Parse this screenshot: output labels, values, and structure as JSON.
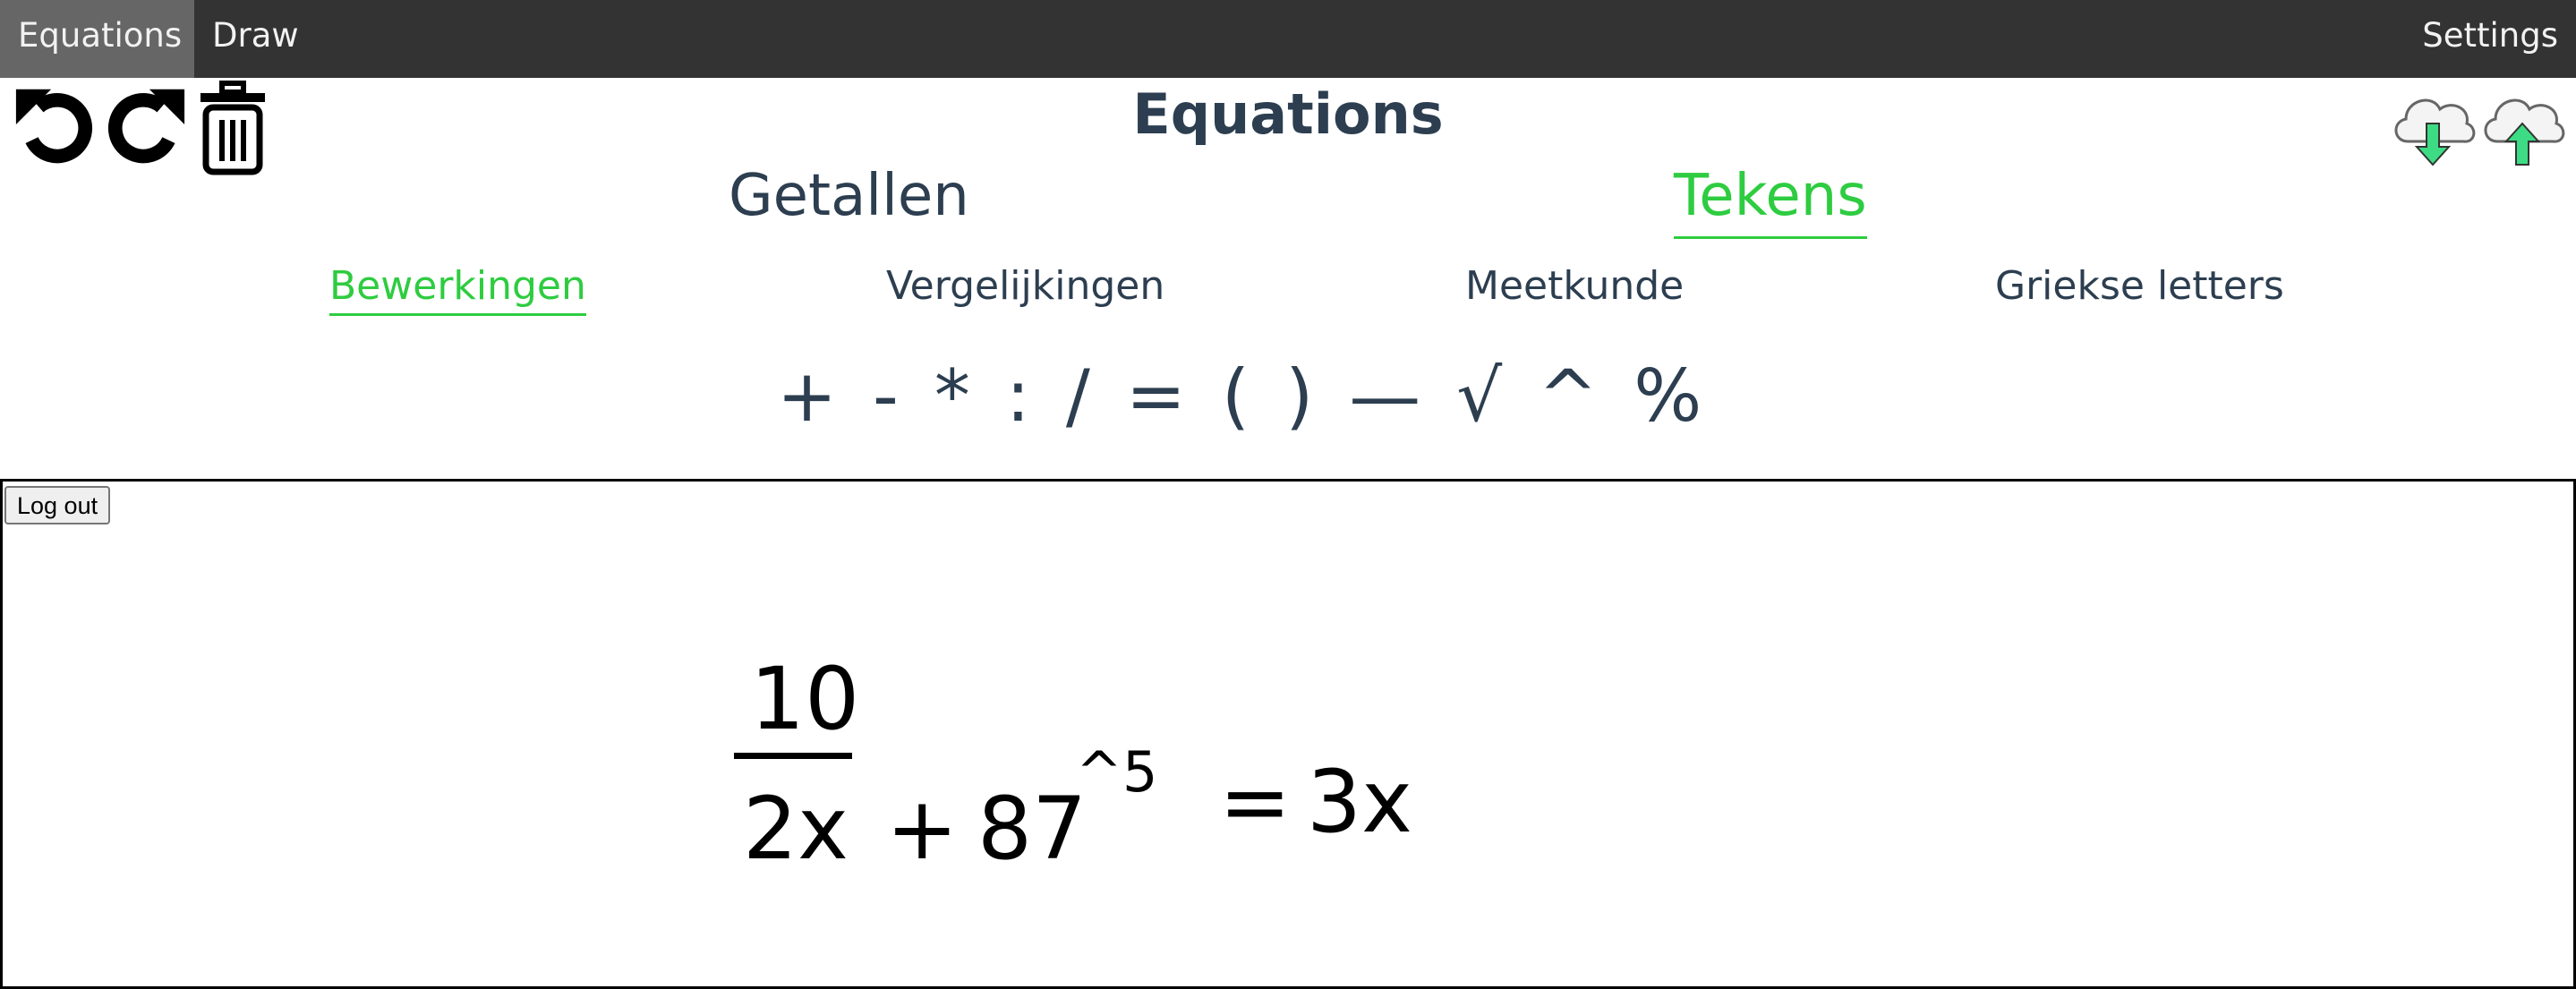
{
  "nav": {
    "equations": "Equations",
    "draw": "Draw",
    "settings": "Settings"
  },
  "toolbar": {
    "icons": [
      "undo-icon",
      "redo-icon",
      "trash-icon",
      "cloud-download-icon",
      "cloud-upload-icon"
    ]
  },
  "title": "Equations",
  "main_tabs": {
    "getallen": "Getallen",
    "tekens": "Tekens",
    "active": "Tekens"
  },
  "sub_tabs": {
    "bewerkingen": "Bewerkingen",
    "vergelijkingen": "Vergelijkingen",
    "meetkunde": "Meetkunde",
    "griekse": "Griekse letters",
    "active": "Bewerkingen"
  },
  "symbols": [
    "+",
    "-",
    "*",
    ":",
    "/",
    "=",
    "(",
    ")",
    "—",
    "√",
    "^",
    "%"
  ],
  "canvas": {
    "logout": "Log out",
    "equation": {
      "numerator": "10",
      "denominator": "2x",
      "plus": "+",
      "base": "87",
      "exponent": "^5",
      "equals": "=",
      "rhs": "3x"
    }
  },
  "colors": {
    "nav_bg": "#333333",
    "nav_active": "#666666",
    "accent": "#2ecc40",
    "text": "#2c3e50",
    "cloud_arrow": "#3ddc84"
  }
}
